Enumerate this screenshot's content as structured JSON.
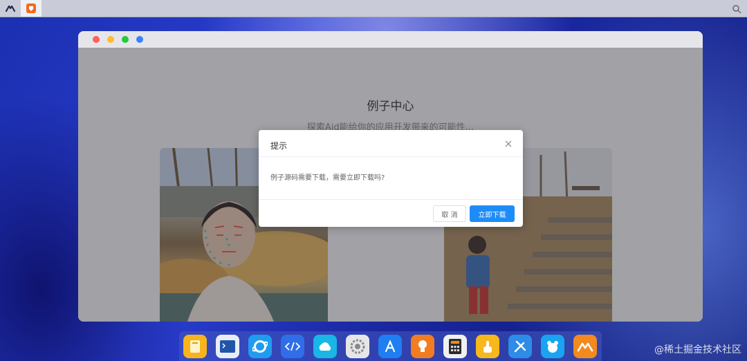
{
  "window": {
    "page_title": "例子中心",
    "page_subtitle": "探索Aid能给你的应用开发带来的可能性..."
  },
  "dialog": {
    "title": "提示",
    "message": "例子源码需要下载，需要立即下载吗?",
    "cancel_label": "取 消",
    "confirm_label": "立即下载"
  },
  "dock": {
    "apps": [
      "files-icon",
      "terminal-icon",
      "browser-icon",
      "code-editor-icon",
      "cloud-icon",
      "settings-icon",
      "app-store-icon",
      "bulb-icon",
      "calculator-icon",
      "touch-icon",
      "tools-icon",
      "bear-icon",
      "aidlux-icon"
    ]
  },
  "watermark": "@稀土掘金技术社区",
  "colors": {
    "primary": "#1e8cf7",
    "traffic_red": "#ff5f57",
    "traffic_yellow": "#febc2e",
    "traffic_green": "#28c840",
    "traffic_blue": "#3b82f6"
  }
}
